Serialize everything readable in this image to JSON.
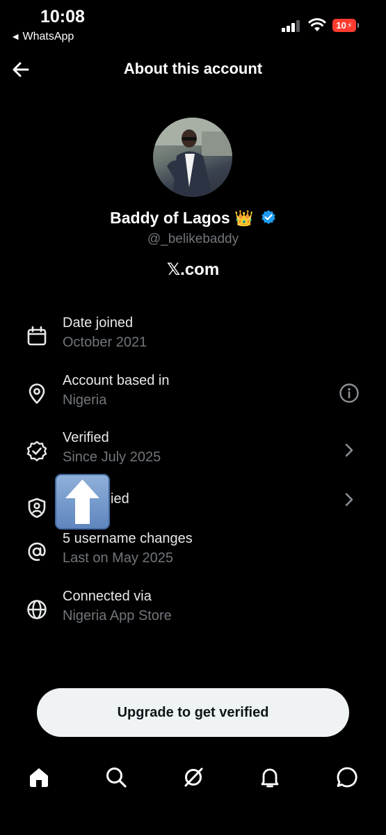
{
  "status_bar": {
    "time": "10:08",
    "back_app": "WhatsApp",
    "battery": "10"
  },
  "header": {
    "title": "About this account",
    "back_icon": "arrow-left-icon"
  },
  "profile": {
    "name": "Baddy of Lagos",
    "emoji": "👑",
    "verified_badge_color": "#1d9bf0",
    "handle": "@_belikebaddy",
    "domain": "𝕏.com"
  },
  "info_items": [
    {
      "icon": "calendar-icon",
      "title": "Date joined",
      "subtitle": "October 2021",
      "action": ""
    },
    {
      "icon": "location-pin-icon",
      "title": "Account based in",
      "subtitle": "Nigeria",
      "action": "info-icon"
    },
    {
      "icon": "verified-check-icon",
      "title": "Verified",
      "subtitle": "Since July 2025",
      "action": "chevron-right-icon"
    },
    {
      "icon": "shield-user-icon",
      "title": "ied",
      "subtitle": "",
      "action": "chevron-right-icon"
    },
    {
      "icon": "at-sign-icon",
      "title": "5 username changes",
      "subtitle": "Last on May 2025",
      "action": ""
    },
    {
      "icon": "globe-icon",
      "title": "Connected via",
      "subtitle": "Nigeria App Store",
      "action": ""
    }
  ],
  "upgrade_button": "Upgrade to get verified",
  "tabbar": [
    "home-icon",
    "search-icon",
    "grok-icon",
    "bell-icon",
    "messages-icon"
  ],
  "overlay": "up-arrow-emoji",
  "colors": {
    "background": "#000000",
    "secondary_text": "#71767b",
    "button_bg": "#eff3f4"
  }
}
